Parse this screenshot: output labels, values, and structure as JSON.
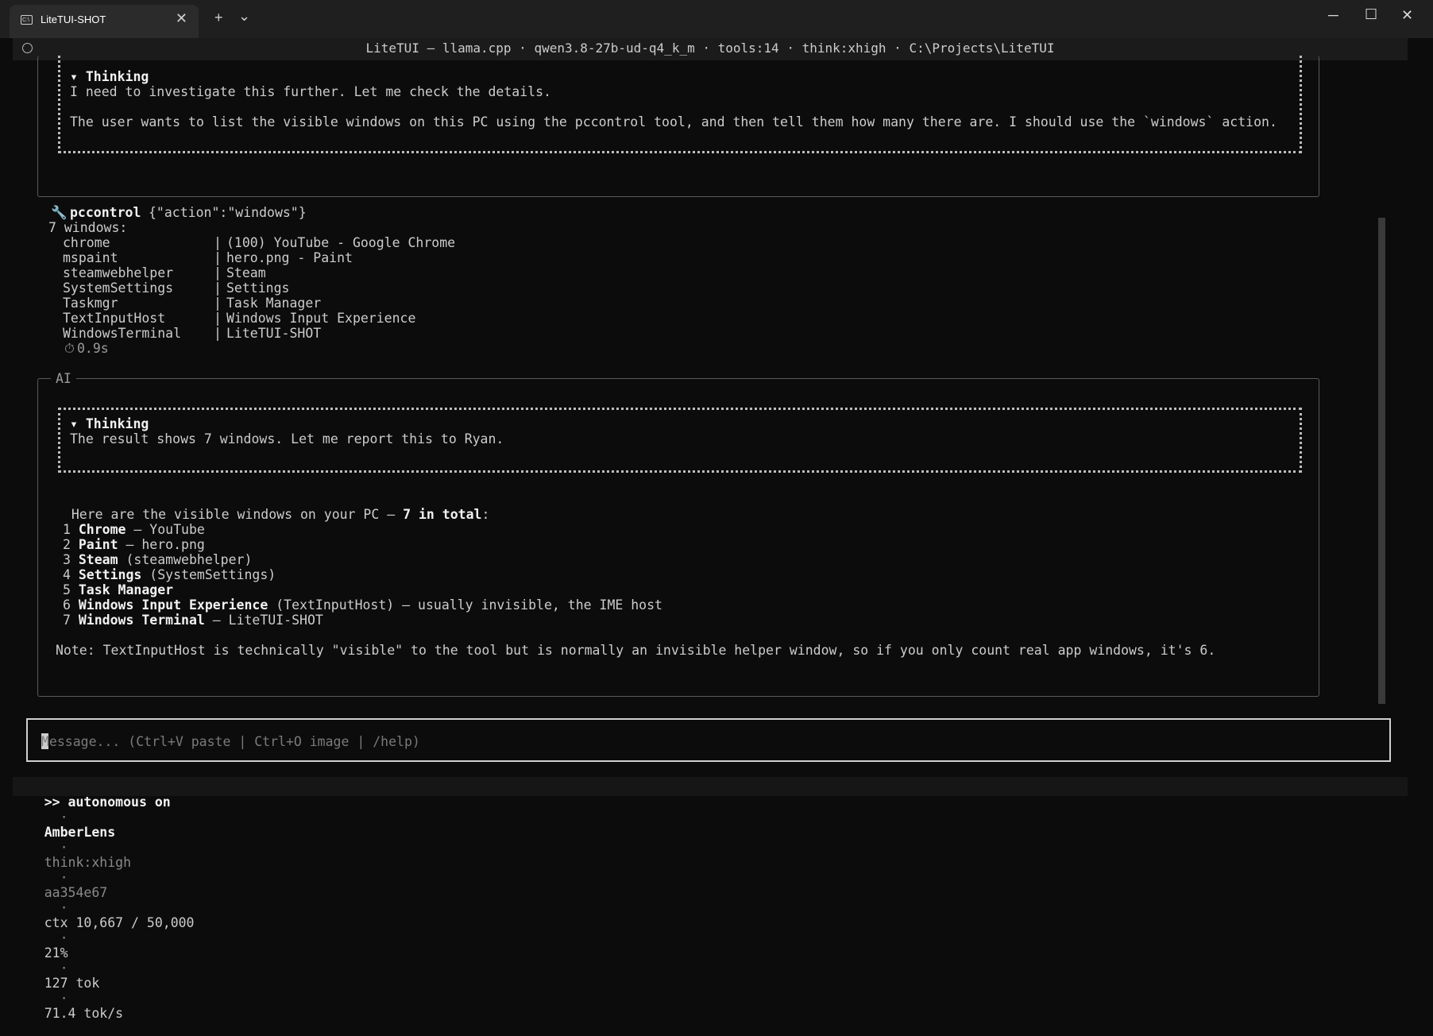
{
  "window": {
    "tab_title": "LiteTUI-SHOT",
    "tab_icon": "terminal-icon",
    "new_tab": "+",
    "tab_menu": "⌄",
    "tab_close": "✕",
    "minimize": "─",
    "maximize": "☐",
    "close": "✕"
  },
  "header": {
    "text": "LiteTUI — llama.cpp · qwen3.8-27b-ud-q4_k_m · tools:14 · think:xhigh · C:\\Projects\\LiteTUI"
  },
  "thinking1": {
    "heading": "▾ Thinking",
    "line1": "I need to investigate this further. Let me check the details.",
    "line2": "The user wants to list the visible windows on this PC using the pccontrol tool, and then tell them how many there are. I should use the `windows` action."
  },
  "tool": {
    "icon": "wrench-icon",
    "name": "pccontrol",
    "args": "{\"action\":\"windows\"}",
    "summary": "7 windows:",
    "rows": [
      {
        "proc": "chrome",
        "title": "(100) YouTube - Google Chrome"
      },
      {
        "proc": "mspaint",
        "title": "hero.png - Paint"
      },
      {
        "proc": "steamwebhelper",
        "title": "Steam"
      },
      {
        "proc": "SystemSettings",
        "title": "Settings"
      },
      {
        "proc": "Taskmgr",
        "title": "Task Manager"
      },
      {
        "proc": "TextInputHost",
        "title": "Windows Input Experience"
      },
      {
        "proc": "WindowsTerminal",
        "title": "LiteTUI-SHOT"
      }
    ],
    "sep": "|",
    "duration": "0.9s"
  },
  "ai": {
    "label": "AI",
    "thinking_heading": "▾ Thinking",
    "thinking_text": "The result shows 7 windows. Let me report this to Ryan.",
    "intro_prefix": "Here are the visible windows on your PC — ",
    "intro_bold": "7 in total",
    "intro_suffix": ":",
    "items": [
      {
        "n": "1",
        "bold": "Chrome",
        "rest": " — YouTube"
      },
      {
        "n": "2",
        "bold": "Paint",
        "rest": " — hero.png"
      },
      {
        "n": "3",
        "bold": "Steam",
        "rest": " (steamwebhelper)"
      },
      {
        "n": "4",
        "bold": "Settings",
        "rest": " (SystemSettings)"
      },
      {
        "n": "5",
        "bold": "Task Manager",
        "rest": ""
      },
      {
        "n": "6",
        "bold": "Windows Input Experience",
        "rest": " (TextInputHost) — usually invisible, the IME host"
      },
      {
        "n": "7",
        "bold": "Windows Terminal",
        "rest": " — LiteTUI-SHOT"
      }
    ],
    "note": "Note: TextInputHost is technically \"visible\" to the tool but is normally an invisible helper window, so if you only count real app windows, it's 6."
  },
  "input": {
    "placeholder": "Message... (Ctrl+V paste | Ctrl+O image | /help)"
  },
  "status": {
    "mode": ">> autonomous on",
    "sep": "·",
    "persona": "AmberLens",
    "think": "think:xhigh",
    "hash": "aa354e67",
    "ctx": "ctx 10,667 / 50,000",
    "pct": "21%",
    "tok": "127 tok",
    "rate": "71.4 tok/s"
  },
  "colors": {
    "background": "#0c0c0c",
    "text": "#cccccc",
    "bold": "#f2f2f2",
    "border": "#5a5a5a"
  }
}
